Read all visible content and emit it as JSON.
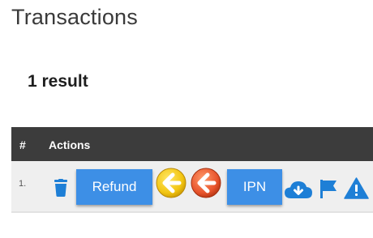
{
  "page": {
    "title": "Transactions"
  },
  "results": {
    "count_label": "1 result"
  },
  "table": {
    "headers": {
      "number": "#",
      "actions": "Actions"
    },
    "rows": [
      {
        "number": "1.",
        "actions": {
          "refund_label": "Refund",
          "ipn_label": "IPN"
        }
      }
    ]
  },
  "icons": {
    "delete": "trash-icon",
    "back_yellow": "arrow-left-yellow-icon",
    "back_orange": "arrow-left-orange-icon",
    "download": "cloud-download-icon",
    "flag": "flag-icon",
    "warning": "warning-icon"
  },
  "colors": {
    "accent_blue": "#3d8fe6",
    "header_dark": "#3c3c3c",
    "row_bg": "#efefef",
    "yellow": "#f2c512",
    "orange": "#e8542c"
  }
}
